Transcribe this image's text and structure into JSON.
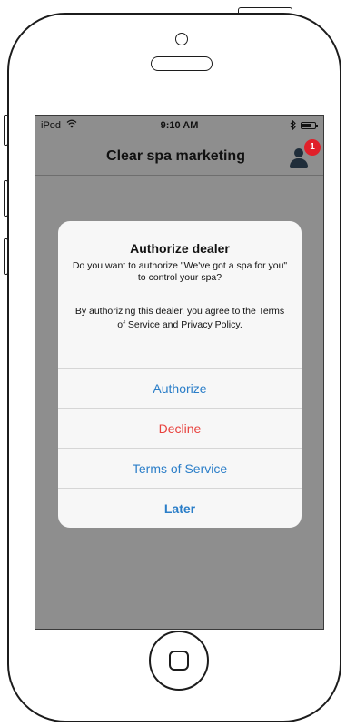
{
  "statusbar": {
    "carrier": "iPod",
    "wifi": "wifi-icon",
    "time": "9:10 AM",
    "bluetooth": "bluetooth-icon",
    "battery": "battery-icon"
  },
  "navbar": {
    "title": "Clear spa marketing",
    "badge_count": "1",
    "user_icon": "user-icon"
  },
  "dialog": {
    "title": "Authorize dealer",
    "message": "Do you want to authorize \"We've got a spa for you\" to control your spa?",
    "message2": "By authorizing this dealer, you agree to the Terms of Service and Privacy Policy.",
    "buttons": [
      {
        "label": "Authorize",
        "color": "#2b7ec8"
      },
      {
        "label": "Decline",
        "color": "#e8423e"
      },
      {
        "label": "Terms of Service",
        "color": "#2b7ec8"
      },
      {
        "label": "Later",
        "color": "#2b7ec8"
      }
    ]
  },
  "colors": {
    "screen_overlay": "#8e8e8e",
    "badge": "#e0202a",
    "dialog_bg": "#f7f7f7"
  }
}
